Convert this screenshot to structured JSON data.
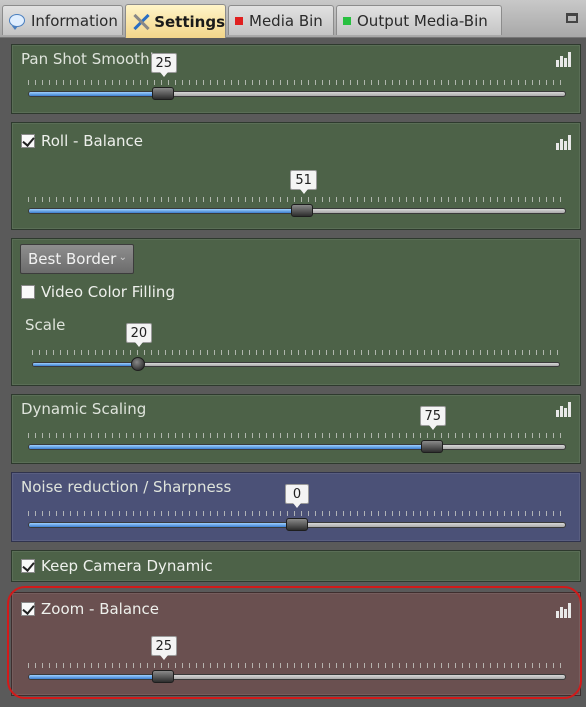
{
  "tabs": [
    {
      "label": "Information",
      "icon": "speech-bubble-icon",
      "active": false
    },
    {
      "label": "Settings",
      "icon": "tools-icon",
      "active": true
    },
    {
      "label": "Media Bin",
      "icon": "red-square-icon",
      "active": false
    },
    {
      "label": "Output Media-Bin",
      "icon": "green-square-icon",
      "active": false
    }
  ],
  "panels": {
    "pan_shot": {
      "title": "Pan Shot Smoothing",
      "value": "25",
      "fraction": 0.25
    },
    "roll": {
      "title": "Roll - Balance",
      "checked": true,
      "value": "51",
      "fraction": 0.51
    },
    "border": {
      "dropdown": "Best Border",
      "video_color_filling": {
        "label": "Video Color Filling",
        "checked": false
      },
      "scale_label": "Scale",
      "value": "20",
      "fraction": 0.2
    },
    "dynamic_scaling": {
      "title": "Dynamic Scaling",
      "value": "75",
      "fraction": 0.75
    },
    "noise": {
      "title": "Noise reduction / Sharpness",
      "value": "0",
      "fraction": 0.5
    },
    "keep_camera": {
      "label": "Keep Camera Dynamic",
      "checked": true
    },
    "zoom": {
      "title": "Zoom - Balance",
      "checked": true,
      "value": "25",
      "fraction": 0.25
    }
  },
  "colors": {
    "panel_green": "#4d6248",
    "panel_blue": "#4b5177",
    "panel_red": "#6a5050",
    "highlight": "#d21a1a",
    "slider_fill": "#3d7fcf"
  }
}
